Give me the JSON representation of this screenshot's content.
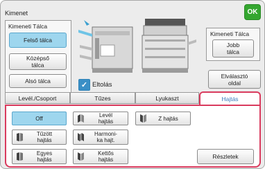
{
  "window": {
    "title": "Kimenet",
    "ok_label": "OK"
  },
  "output_tray": {
    "label": "Kimeneti Tálca",
    "options": [
      {
        "label": "Felső tálca",
        "selected": true
      },
      {
        "label": "Középső\ntálca",
        "selected": false
      },
      {
        "label": "Alsó tálca",
        "selected": false
      }
    ]
  },
  "right_tray": {
    "label": "Kimeneti Tálca",
    "option": "Jobb\ntálca"
  },
  "separator_label": "Elválasztó\noldal",
  "offset": {
    "label": "Eltolás",
    "checked": true
  },
  "tabs": [
    "Levél./Csoport",
    "Tűzes",
    "Lyukaszt",
    "Hajtás"
  ],
  "active_tab": "Hajtás",
  "fold_options": [
    {
      "label": "Off",
      "selected": true,
      "icon": "none"
    },
    {
      "label": "Levél\nhajtás",
      "selected": false,
      "icon": "letter-fold-icon"
    },
    {
      "label": "Z hajtás",
      "selected": false,
      "icon": "z-fold-icon"
    },
    {
      "label": "Tűzött\nhajtás",
      "selected": false,
      "icon": "saddle-fold-icon"
    },
    {
      "label": "Harmoni-\nka hajt.",
      "selected": false,
      "icon": "accordion-fold-icon"
    },
    {
      "label": "Egyes\nhajtás",
      "selected": false,
      "icon": "single-fold-icon"
    },
    {
      "label": "Kettős\nhajtás",
      "selected": false,
      "icon": "double-fold-icon"
    }
  ],
  "details_label": "Részletek",
  "colors": {
    "accent_selected": "#9ed6ee",
    "tab_highlight": "#d93b5e",
    "ok_green": "#34a62f",
    "checkbox_blue": "#3a8fc6"
  }
}
